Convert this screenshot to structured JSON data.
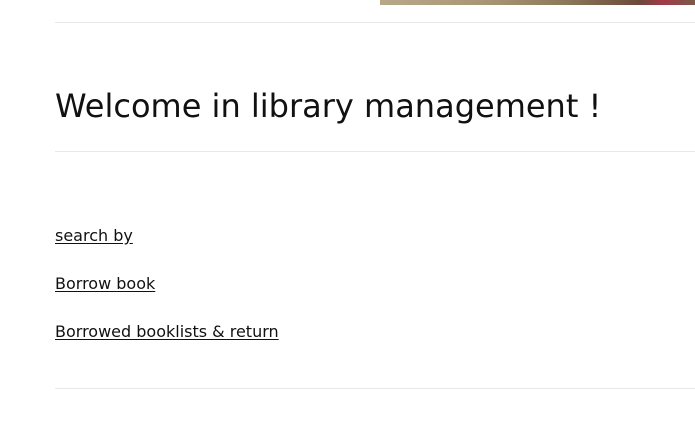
{
  "header": {
    "image_colors": [
      "#b8a88a",
      "#8b7658",
      "#a23a4a"
    ]
  },
  "main": {
    "title": "Welcome in library management !",
    "links": [
      {
        "label": "search by"
      },
      {
        "label": "Borrow book"
      },
      {
        "label": "Borrowed booklists & return"
      }
    ]
  },
  "colors": {
    "text": "#111111",
    "divider": "#e8e8e8",
    "background": "#ffffff"
  }
}
